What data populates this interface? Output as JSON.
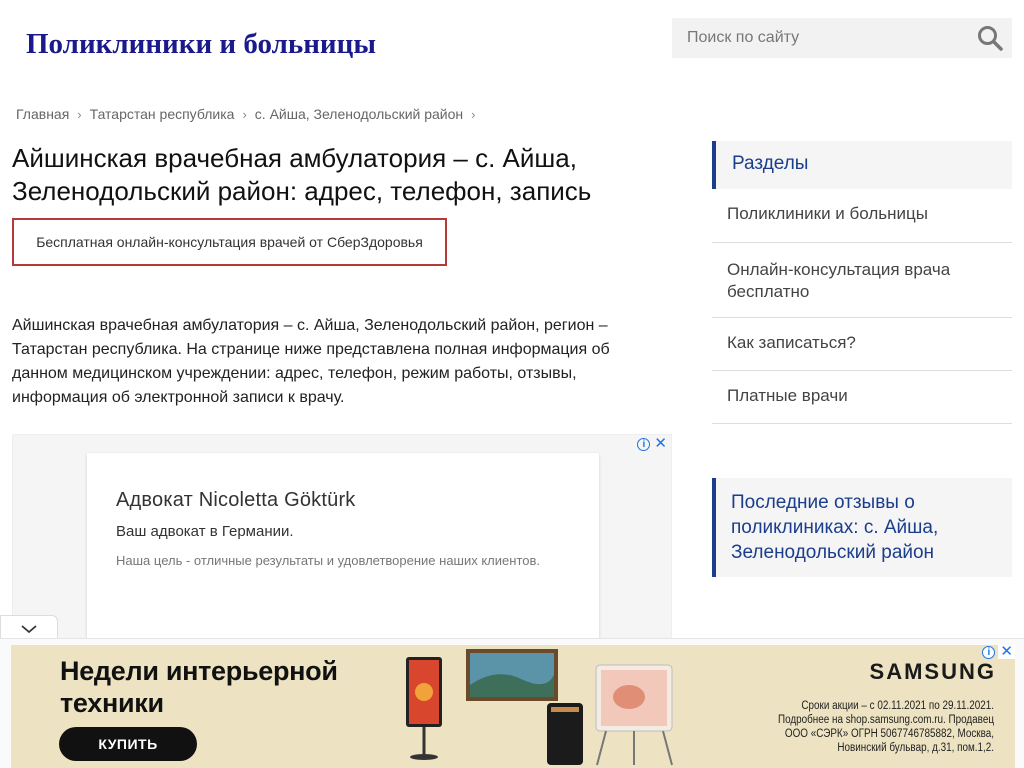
{
  "header": {
    "logo": "Поликлиники и больницы",
    "search_placeholder": "Поиск по сайту"
  },
  "breadcrumb": [
    "Главная",
    "Татарстан республика",
    "с. Айша, Зеленодольский район"
  ],
  "page": {
    "title": "Айшинская врачебная амбулатория – с. Айша, Зеленодольский район: адрес, телефон, запись",
    "consult_button": "Бесплатная онлайн-консультация врачей от СберЗдоровья",
    "intro": "Айшинская врачебная амбулатория – с. Айша, Зеленодольский район, регион – Татарстан республика. На странице ниже представлена полная информация об данном медицинском учреждении: адрес, телефон, режим работы, отзывы, информация об электронной записи к врачу."
  },
  "ad": {
    "title": "Адвокат Nicoletta Göktürk",
    "subtitle": "Ваш адвокат в Германии.",
    "description": "Наша цель - отличные результаты и удовлетворение наших клиентов."
  },
  "sidebar": {
    "sections_title": "Разделы",
    "items": [
      "Поликлиники и больницы",
      "Онлайн-консультация врача бесплатно",
      "Как записаться?",
      "Платные врачи"
    ],
    "reviews_title": "Последние отзывы о поликлиниках: с. Айша, Зеленодольский район"
  },
  "banner": {
    "headline": "Недели интерьерной техники",
    "button": "КУПИТЬ",
    "brand": "SAMSUNG",
    "legal_lines": [
      "Сроки акции – с 02.11.2021 по 29.11.2021.",
      "Подробнее на shop.samsung.com.ru. Продавец",
      "ООО «СЭРК» ОГРН 5067746785882, Москва,",
      "Новинский бульвар, д.31, пом.1,2."
    ]
  },
  "colors": {
    "logo": "#1a1a8c",
    "accent": "#1a3d8c",
    "consult_border": "#b53a3a",
    "banner_bg": "#ede3c2"
  }
}
